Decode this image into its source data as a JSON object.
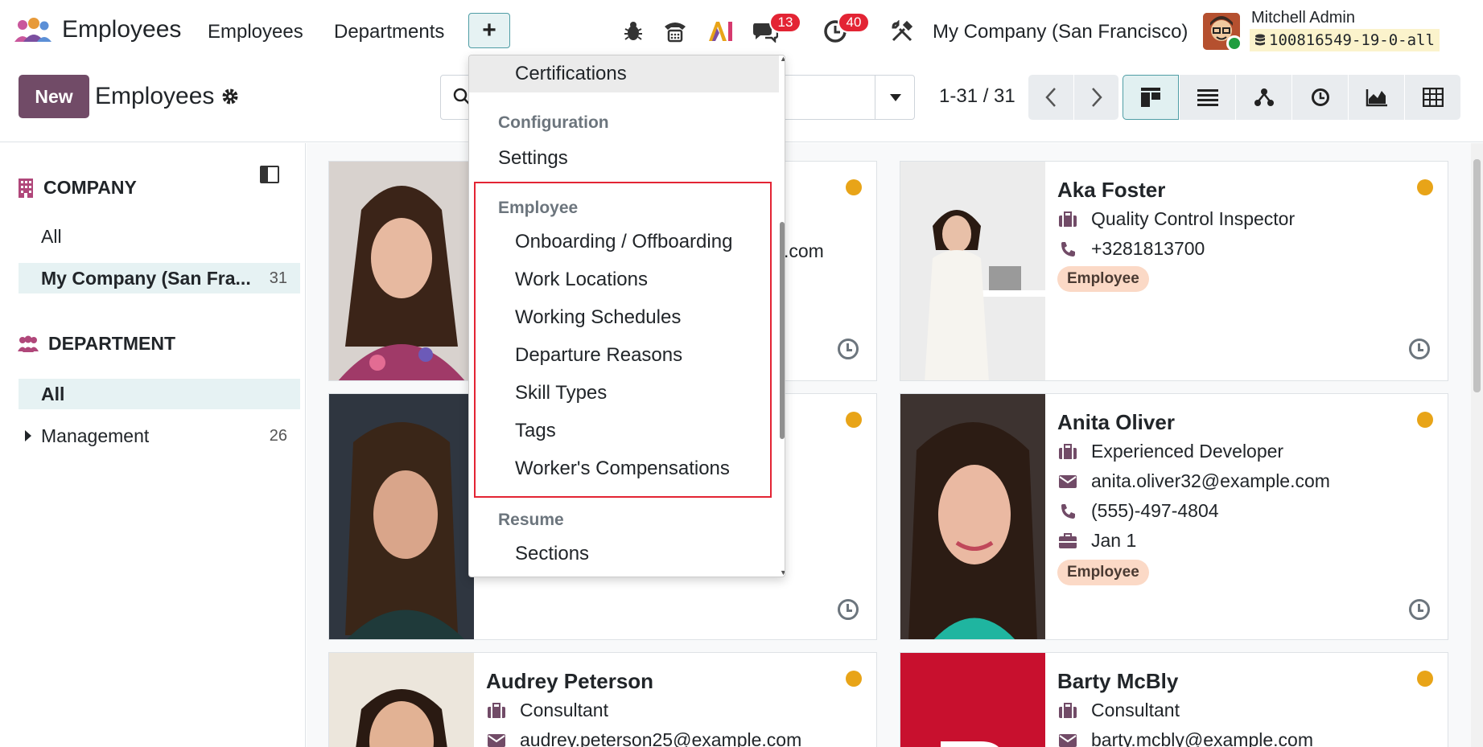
{
  "topnav": {
    "app_name": "Employees",
    "menu": [
      "Employees",
      "Departments"
    ],
    "plus": "+",
    "chat_badge": "13",
    "activity_badge": "40",
    "company": "My Company (San Francisco)",
    "user_name": "Mitchell Admin",
    "db_name": "100816549-19-0-all"
  },
  "control": {
    "new_label": "New",
    "title": "Employees",
    "pager": "1-31 / 31"
  },
  "sidebar": {
    "company_heading": "COMPANY",
    "company_items": [
      {
        "label": "All",
        "count": ""
      },
      {
        "label": "My Company (San Fra...",
        "count": "31"
      }
    ],
    "department_heading": "DEPARTMENT",
    "department_items": [
      {
        "label": "All",
        "count": ""
      },
      {
        "label": "Management",
        "count": "26"
      }
    ]
  },
  "dropdown": {
    "items_top": [
      "Certifications"
    ],
    "configuration_header": "Configuration",
    "settings": "Settings",
    "employee_header": "Employee",
    "employee_items": [
      "Onboarding / Offboarding",
      "Work Locations",
      "Working Schedules",
      "Departure Reasons",
      "Skill Types",
      "Tags",
      "Worker's Compensations"
    ],
    "resume_header": "Resume",
    "resume_items": [
      "Sections"
    ]
  },
  "cards": [
    {
      "name": "",
      "lines": [
        ".com"
      ],
      "tag": ""
    },
    {
      "name": "Aka Foster",
      "job": "Quality Control Inspector",
      "phone": "+3281813700",
      "tag": "Employee"
    },
    {
      "name": "",
      "lines": [],
      "tag": ""
    },
    {
      "name": "Anita Oliver",
      "job": "Experienced Developer",
      "email": "anita.oliver32@example.com",
      "phone": "(555)-497-4804",
      "date": "Jan 1",
      "tag": "Employee"
    },
    {
      "name": "Audrey Peterson",
      "job": "Consultant",
      "email": "audrey.peterson25@example.com"
    },
    {
      "name": "Barty McBly",
      "job": "Consultant",
      "email": "barty.mcbly@example.com"
    }
  ],
  "colors": {
    "brand": "#714b67",
    "accent": "#4f9da5",
    "highlight_border": "#e32434",
    "status_dot": "#e8a418",
    "tag_bg": "#fbd9c6"
  }
}
